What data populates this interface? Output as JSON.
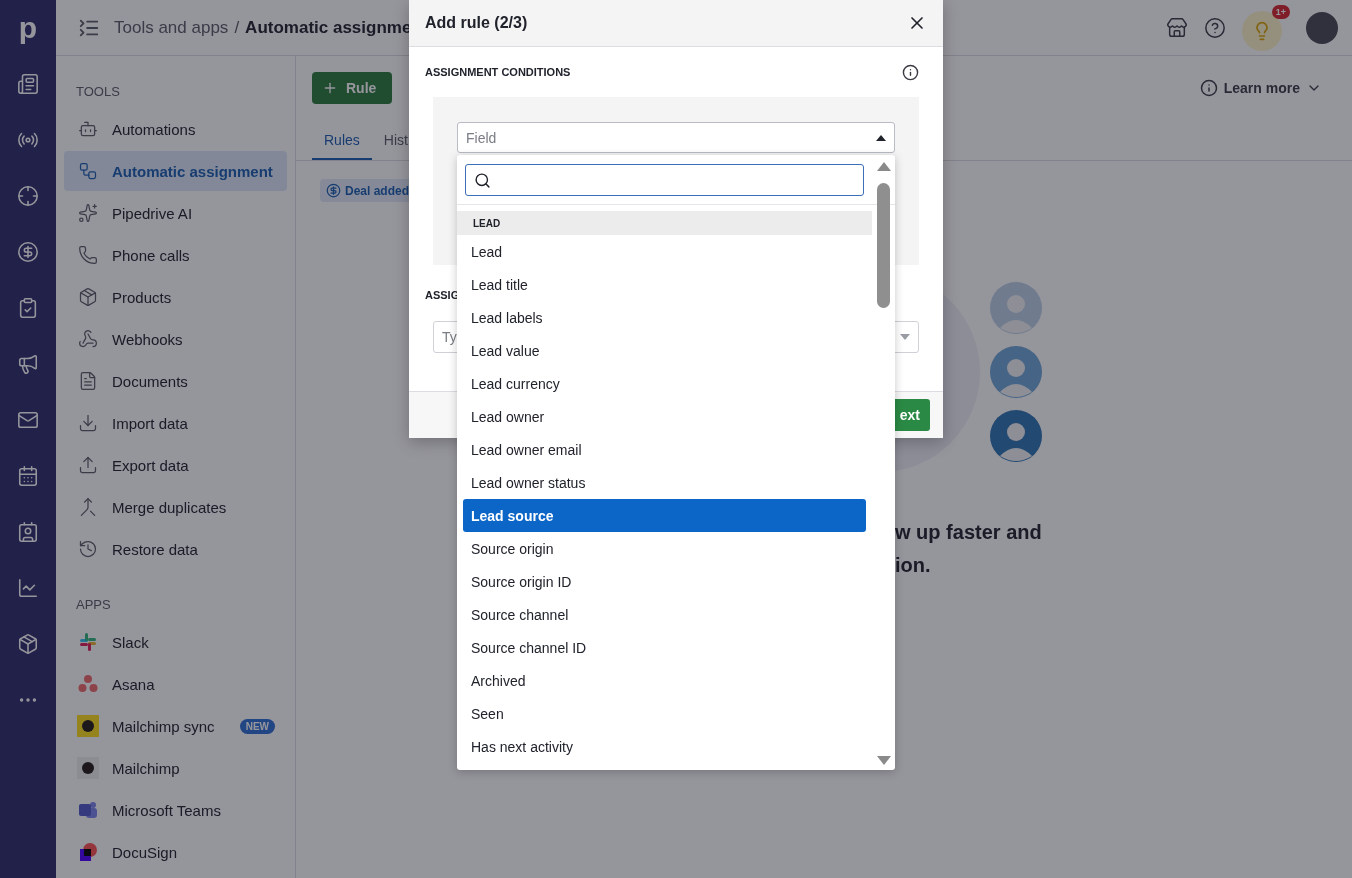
{
  "rail": {
    "logo": "p"
  },
  "topbar": {
    "breadcrumb_parent": "Tools and apps",
    "separator": "/",
    "breadcrumb_current": "Automatic assignme",
    "notification_badge": "1+"
  },
  "sidebar": {
    "sections": [
      {
        "title": "TOOLS",
        "items": [
          {
            "label": "Automations",
            "selected": false
          },
          {
            "label": "Automatic assignment",
            "selected": true
          },
          {
            "label": "Pipedrive AI",
            "selected": false
          },
          {
            "label": "Phone calls",
            "selected": false
          },
          {
            "label": "Products",
            "selected": false
          },
          {
            "label": "Webhooks",
            "selected": false
          },
          {
            "label": "Documents",
            "selected": false
          },
          {
            "label": "Import data",
            "selected": false
          },
          {
            "label": "Export data",
            "selected": false
          },
          {
            "label": "Merge duplicates",
            "selected": false
          },
          {
            "label": "Restore data",
            "selected": false
          }
        ]
      },
      {
        "title": "APPS",
        "items": [
          {
            "label": "Slack",
            "selected": false
          },
          {
            "label": "Asana",
            "selected": false
          },
          {
            "label": "Mailchimp sync",
            "selected": false,
            "badge": "NEW"
          },
          {
            "label": "Mailchimp",
            "selected": false
          },
          {
            "label": "Microsoft Teams",
            "selected": false
          },
          {
            "label": "DocuSign",
            "selected": false
          }
        ]
      }
    ]
  },
  "main": {
    "add_button": "Rule",
    "learn_more": "Learn more",
    "tabs": [
      {
        "label": "Rules",
        "selected": true
      },
      {
        "label": "Hist",
        "selected": false
      }
    ],
    "trigger_chip": "Deal added",
    "headline": [
      "w up faster and",
      "ion."
    ]
  },
  "modal": {
    "title": "Add rule (2/3)",
    "section_1": "ASSIGNMENT CONDITIONS",
    "field_select": {
      "placeholder": "Field",
      "expanded": true
    },
    "section_2": "ASSIG",
    "type_field": {
      "placeholder": "Ty"
    },
    "next_button": "ext"
  },
  "dropdown": {
    "group": "LEAD",
    "options": [
      {
        "label": "Lead",
        "selected": false
      },
      {
        "label": "Lead title",
        "selected": false
      },
      {
        "label": "Lead labels",
        "selected": false
      },
      {
        "label": "Lead value",
        "selected": false
      },
      {
        "label": "Lead currency",
        "selected": false
      },
      {
        "label": "Lead owner",
        "selected": false
      },
      {
        "label": "Lead owner email",
        "selected": false
      },
      {
        "label": "Lead owner status",
        "selected": false
      },
      {
        "label": "Lead source",
        "selected": true
      },
      {
        "label": "Source origin",
        "selected": false
      },
      {
        "label": "Source origin ID",
        "selected": false
      },
      {
        "label": "Source channel",
        "selected": false
      },
      {
        "label": "Source channel ID",
        "selected": false
      },
      {
        "label": "Archived",
        "selected": false
      },
      {
        "label": "Seen",
        "selected": false
      },
      {
        "label": "Has next activity",
        "selected": false
      }
    ]
  }
}
